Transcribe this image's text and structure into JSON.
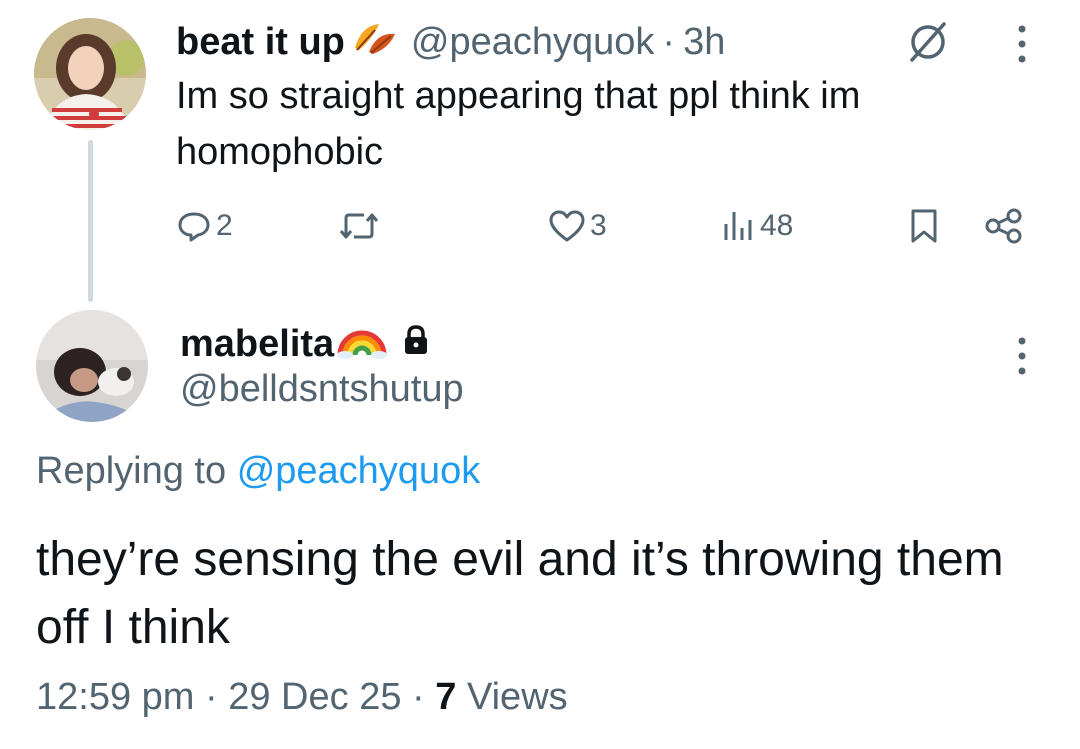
{
  "parent_tweet": {
    "display_name": "beat it up",
    "name_emoji": "fallen-leaf-emoji",
    "handle": "@peachyquok",
    "separator": "·",
    "time_ago": "3h",
    "text": "Im so straight appearing that ppl think im homophobic",
    "actions": {
      "replies": "2",
      "reposts": "",
      "likes": "3",
      "views": "48"
    }
  },
  "reply_tweet": {
    "display_name": "mabelita",
    "name_emoji": "rainbow-emoji",
    "protected_icon": "lock-icon",
    "handle": "@belldsntshutup",
    "replying_label": "Replying to",
    "replying_to": "@peachyquok",
    "text": "they’re sensing the evil and it’s throwing them off I think",
    "time": "12:59 pm",
    "separator": "·",
    "date": "29 Dec 25",
    "views_count": "7",
    "views_label": "Views"
  },
  "colors": {
    "text_primary": "#0f1419",
    "text_secondary": "#536471",
    "link": "#1d9bf0",
    "thread_line": "#cfd9de"
  }
}
